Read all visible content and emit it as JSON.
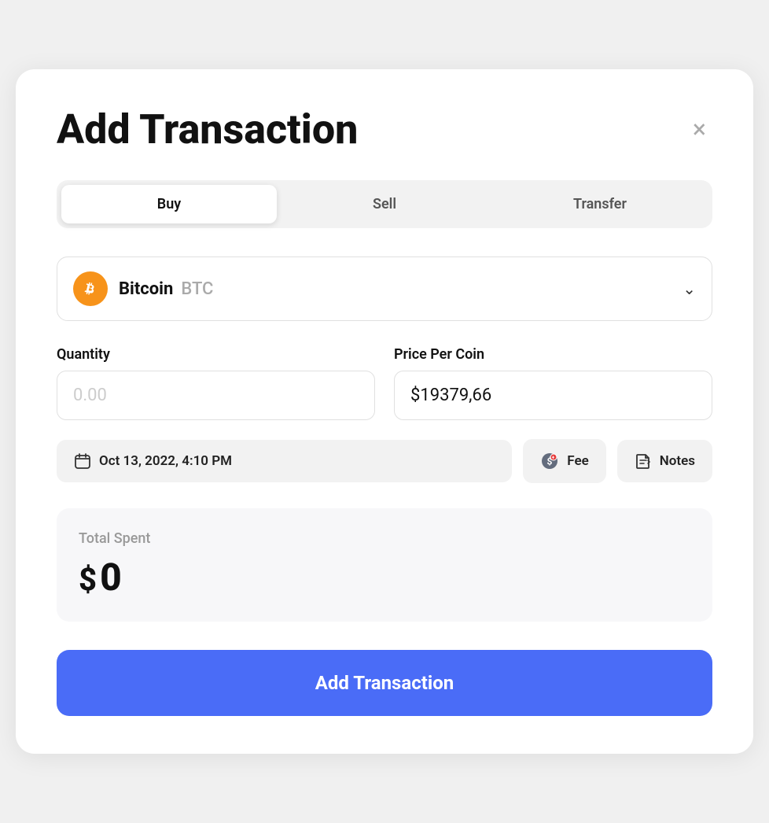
{
  "modal": {
    "title": "Add Transaction",
    "close_label": "×"
  },
  "tabs": [
    {
      "id": "buy",
      "label": "Buy",
      "active": true
    },
    {
      "id": "sell",
      "label": "Sell",
      "active": false
    },
    {
      "id": "transfer",
      "label": "Transfer",
      "active": false
    }
  ],
  "coin_selector": {
    "name": "Bitcoin",
    "symbol": "BTC",
    "icon_color": "#f7931a"
  },
  "quantity_field": {
    "label": "Quantity",
    "placeholder": "0.00",
    "value": ""
  },
  "price_field": {
    "label": "Price Per Coin",
    "placeholder": "",
    "value": "$19379,66"
  },
  "date_button": {
    "label": "Oct 13, 2022, 4:10 PM"
  },
  "fee_button": {
    "label": "Fee"
  },
  "notes_button": {
    "label": "Notes"
  },
  "total_section": {
    "label": "Total Spent",
    "currency_symbol": "$",
    "value": "0"
  },
  "submit_button": {
    "label": "Add Transaction"
  }
}
